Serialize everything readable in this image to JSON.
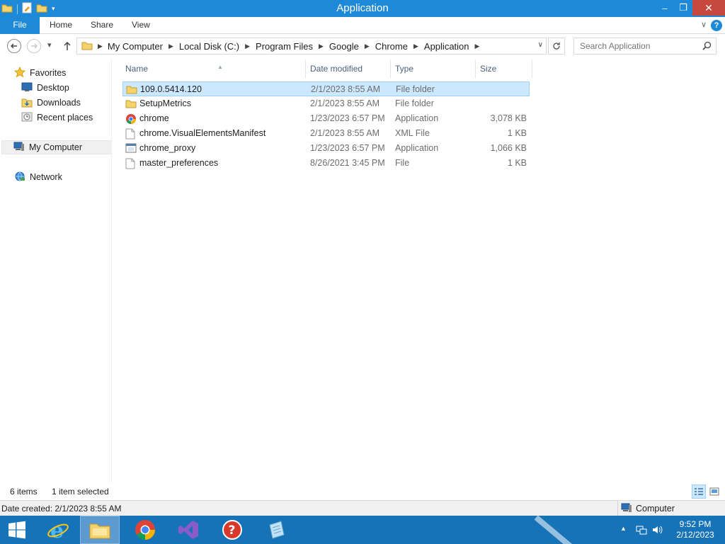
{
  "window": {
    "title": "Application",
    "controls": {
      "minimize": "–",
      "maximize": "❐",
      "close": "✕"
    }
  },
  "ribbon": {
    "tabs": [
      {
        "label": "File",
        "active": true
      },
      {
        "label": "Home"
      },
      {
        "label": "Share"
      },
      {
        "label": "View"
      }
    ],
    "expand_glyph": "∨",
    "help_glyph": "?"
  },
  "nav": {
    "breadcrumb": [
      "My Computer",
      "Local Disk (C:)",
      "Program Files",
      "Google",
      "Chrome",
      "Application"
    ],
    "search_placeholder": "Search Application"
  },
  "sidebar": {
    "favorites_label": "Favorites",
    "favorites": [
      {
        "label": "Desktop",
        "icon": "desktop-icon"
      },
      {
        "label": "Downloads",
        "icon": "downloads-folder-icon"
      },
      {
        "label": "Recent places",
        "icon": "recent-places-icon"
      }
    ],
    "computer_label": "My Computer",
    "network_label": "Network"
  },
  "columns": {
    "name": "Name",
    "date": "Date modified",
    "type": "Type",
    "size": "Size"
  },
  "files": [
    {
      "name": "109.0.5414.120",
      "date": "2/1/2023 8:55 AM",
      "type": "File folder",
      "size": "",
      "icon": "folder-icon",
      "selected": true
    },
    {
      "name": "SetupMetrics",
      "date": "2/1/2023 8:55 AM",
      "type": "File folder",
      "size": "",
      "icon": "folder-icon"
    },
    {
      "name": "chrome",
      "date": "1/23/2023 6:57 PM",
      "type": "Application",
      "size": "3,078 KB",
      "icon": "chrome-icon"
    },
    {
      "name": "chrome.VisualElementsManifest",
      "date": "2/1/2023 8:55 AM",
      "type": "XML File",
      "size": "1 KB",
      "icon": "xml-file-icon"
    },
    {
      "name": "chrome_proxy",
      "date": "1/23/2023 6:57 PM",
      "type": "Application",
      "size": "1,066 KB",
      "icon": "application-icon"
    },
    {
      "name": "master_preferences",
      "date": "8/26/2021 3:45 PM",
      "type": "File",
      "size": "1 KB",
      "icon": "file-icon"
    }
  ],
  "status": {
    "item_count": "6 items",
    "selection": "1 item selected"
  },
  "details": {
    "date_created": "Date created: 2/1/2023 8:55 AM",
    "zone": "Computer"
  },
  "taskbar": {
    "apps": [
      "internet-explorer",
      "file-explorer",
      "chrome",
      "visual-studio",
      "help",
      "notepad"
    ],
    "time": "9:52 PM",
    "date": "2/12/2023"
  },
  "colors": {
    "accent": "#1e8ad7",
    "selection_bg": "#cce8ff",
    "selection_border": "#99d1ff",
    "taskbar": "#1773b8",
    "close_button": "#c7483f"
  }
}
